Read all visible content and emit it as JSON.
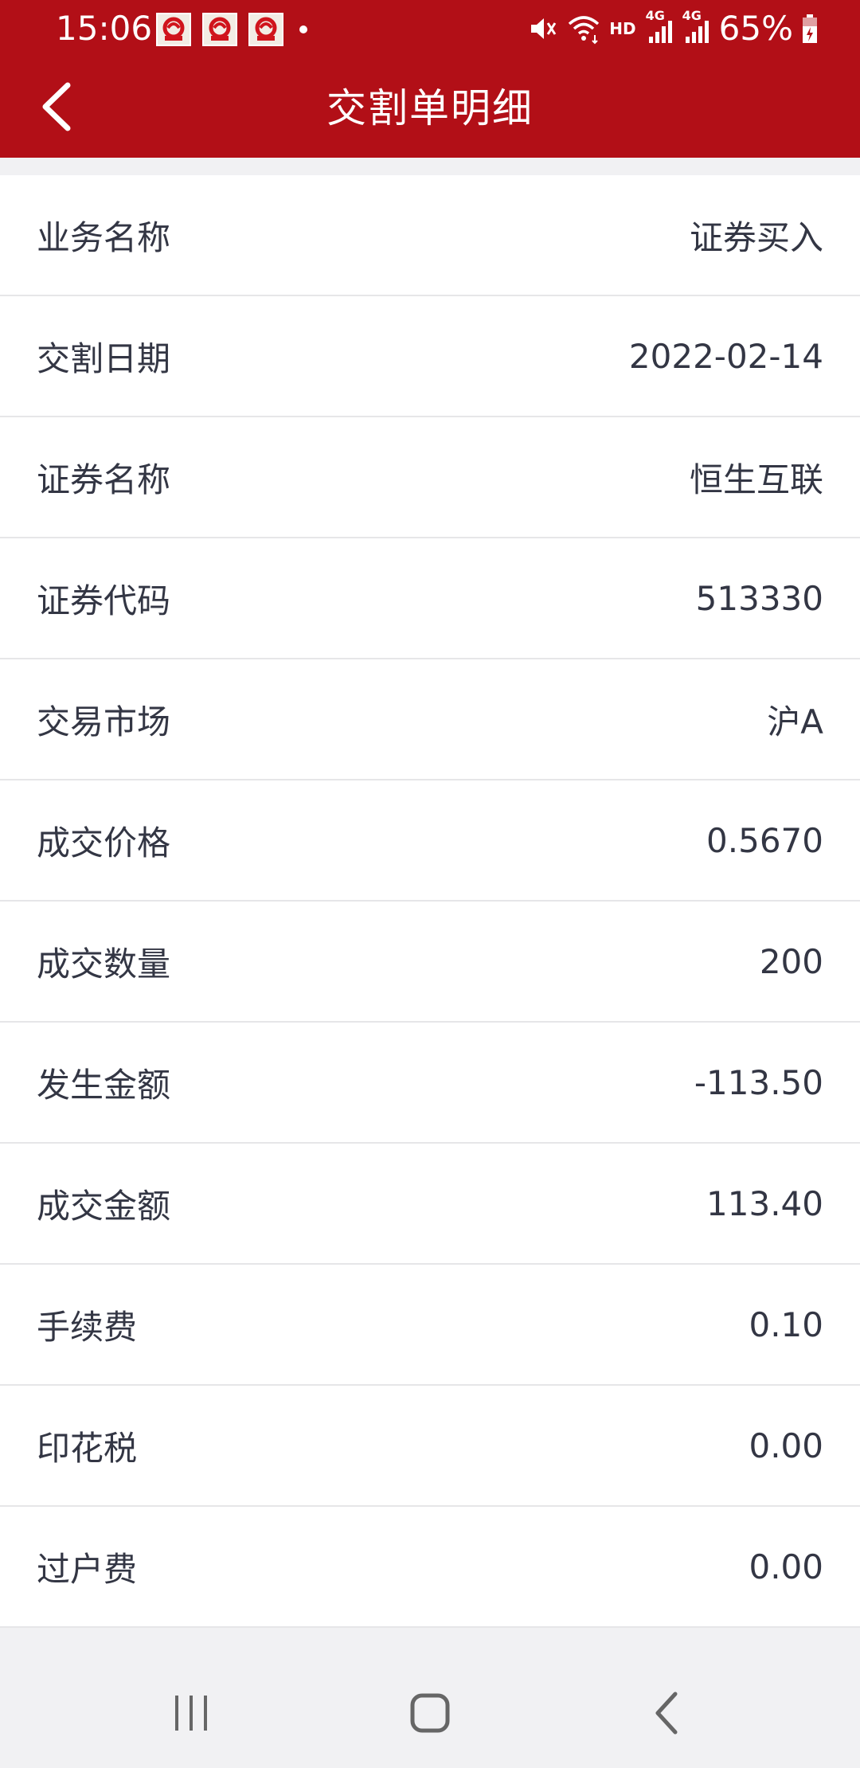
{
  "status_bar": {
    "time": "15:06",
    "network": "HD",
    "signal_1": "4G",
    "signal_2": "4G",
    "battery": "65%",
    "icons": [
      "app-notification-icon",
      "app-notification-icon",
      "app-notification-icon",
      "dot-icon",
      "mute-icon",
      "wifi-icon",
      "signal-icon",
      "signal-icon",
      "battery-charging-icon"
    ]
  },
  "header": {
    "title": "交割单明细",
    "back_icon": "chevron-left-icon",
    "background_color": "#b20f17"
  },
  "details": {
    "rows": [
      {
        "label": "业务名称",
        "value": "证券买入"
      },
      {
        "label": "交割日期",
        "value": "2022-02-14"
      },
      {
        "label": "证券名称",
        "value": "恒生互联"
      },
      {
        "label": "证券代码",
        "value": "513330"
      },
      {
        "label": "交易市场",
        "value": "沪A"
      },
      {
        "label": "成交价格",
        "value": "0.5670"
      },
      {
        "label": "成交数量",
        "value": "200"
      },
      {
        "label": "发生金额",
        "value": "-113.50"
      },
      {
        "label": "成交金额",
        "value": "113.40"
      },
      {
        "label": "手续费",
        "value": "0.10"
      },
      {
        "label": "印花税",
        "value": "0.00"
      },
      {
        "label": "过户费",
        "value": "0.00"
      }
    ]
  },
  "nav_bar": {
    "icons": [
      "recent-apps-icon",
      "home-icon",
      "back-icon"
    ]
  }
}
